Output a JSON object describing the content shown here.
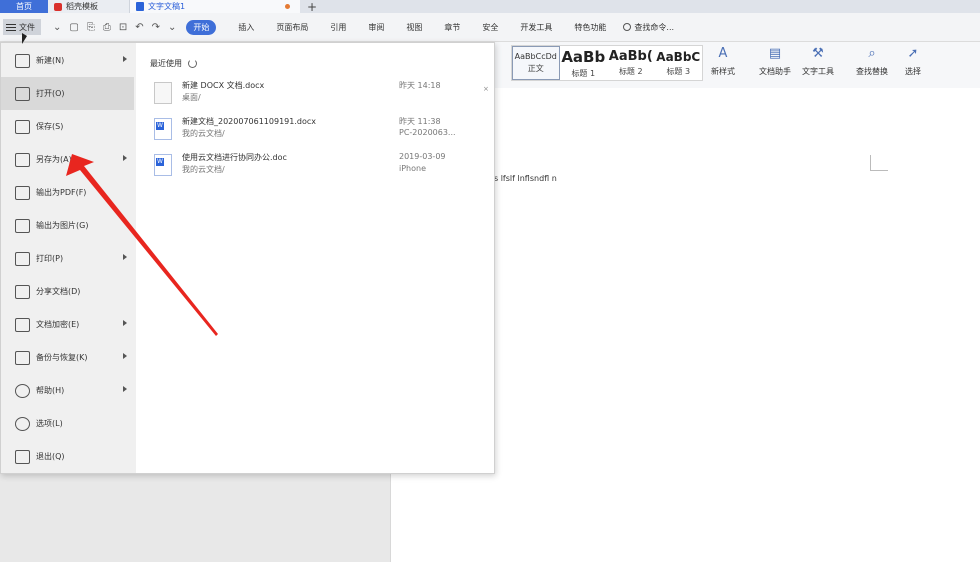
{
  "tabs": {
    "home": "首页",
    "template": "稻壳模板",
    "document": "文字文稿1",
    "add": "+"
  },
  "menubar": {
    "file": "文件",
    "items": [
      "开始",
      "插入",
      "页面布局",
      "引用",
      "审阅",
      "视图",
      "章节",
      "安全",
      "开发工具",
      "特色功能"
    ],
    "active": "开始",
    "search_cmd": "查找命令..."
  },
  "file_menu": {
    "items": [
      {
        "label": "新建(N)",
        "icon": "new-doc-icon",
        "submenu": true
      },
      {
        "label": "打开(O)",
        "icon": "folder-icon",
        "submenu": false,
        "selected": true
      },
      {
        "label": "保存(S)",
        "icon": "save-icon",
        "submenu": false
      },
      {
        "label": "另存为(A)",
        "icon": "save-as-icon",
        "submenu": true
      },
      {
        "label": "输出为PDF(F)",
        "icon": "pdf-icon",
        "submenu": false
      },
      {
        "label": "输出为图片(G)",
        "icon": "image-icon",
        "submenu": false
      },
      {
        "label": "打印(P)",
        "icon": "print-icon",
        "submenu": true
      },
      {
        "label": "分享文档(D)",
        "icon": "share-icon",
        "submenu": false
      },
      {
        "label": "文档加密(E)",
        "icon": "lock-doc-icon",
        "submenu": true
      },
      {
        "label": "备份与恢复(K)",
        "icon": "backup-icon",
        "submenu": true
      },
      {
        "label": "帮助(H)",
        "icon": "help-icon",
        "submenu": true
      },
      {
        "label": "选项(L)",
        "icon": "gear-icon",
        "submenu": false
      },
      {
        "label": "退出(Q)",
        "icon": "exit-icon",
        "submenu": false
      }
    ]
  },
  "recent": {
    "title": "最近使用",
    "files": [
      {
        "name": "新建 DOCX 文档.docx",
        "path": "桌面/",
        "time": "昨天 14:18",
        "location": ""
      },
      {
        "name": "新建文档_20200706110919​1.docx",
        "path": "我的云文档/",
        "time": "昨天 11:38",
        "location": "PC-2020063..."
      },
      {
        "name": "使用云文档进行协同办公.doc",
        "path": "我的云文档/",
        "time": "2019-03-09",
        "location": "iPhone"
      }
    ]
  },
  "styles": {
    "normal_preview": "AaBbCcDd",
    "normal": "正文",
    "h1_preview": "AaBb",
    "h1": "标题 1",
    "h2_preview": "AaBb(",
    "h2": "标题 2",
    "h3_preview": "AaBbC",
    "h3": "标题 3",
    "new_style": "新样式",
    "doc_assistant": "文档助手",
    "text_tools": "文字工具",
    "find_replace": "查找替换",
    "select": "选择"
  },
  "document": {
    "text": "s lfslf lnflsndfl n"
  },
  "colors": {
    "accent": "#3f6fd8",
    "arrow": "#e8261f"
  }
}
